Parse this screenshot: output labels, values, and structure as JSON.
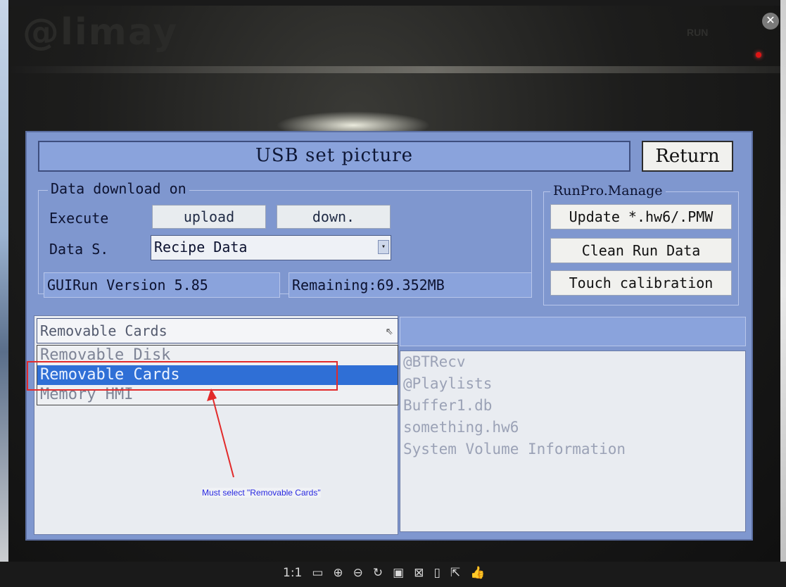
{
  "photo": {
    "brand": "@limay",
    "run_label": "RUN"
  },
  "hmi": {
    "title": "USB set picture",
    "return_label": "Return",
    "data_download": {
      "group_label": "Data download on",
      "execute_label": "Execute",
      "upload_label": "upload",
      "down_label": "down.",
      "data_source_label": "Data S.",
      "data_source_value": "Recipe Data",
      "version": "GUIRun Version 5.85",
      "remaining": "Remaining:69.352MB"
    },
    "runpro": {
      "group_label": "RunPro.Manage",
      "update_label": "Update *.hw6/.PMW",
      "clean_label": "Clean Run Data",
      "touch_label": "Touch calibration"
    },
    "storage_select": {
      "selected": "Removable Cards",
      "options": [
        "Removable Disk",
        "Removable Cards",
        "Memory HMI"
      ]
    },
    "files": [
      "@BTRecv",
      "@Playlists",
      "Buffer1.db",
      "something.hw6",
      "System Volume Information"
    ]
  },
  "annotation": {
    "text": "Must select \"Removable Cards\""
  },
  "toolbar": {
    "zoom_label": "1:1",
    "icons": [
      "fit-screen-icon",
      "zoom-in-icon",
      "zoom-out-icon",
      "rotate-icon",
      "save-icon",
      "bookmark-icon",
      "phone-icon",
      "share-icon",
      "thumbs-up-icon"
    ]
  },
  "colors": {
    "hmi_background": "#7f97cf",
    "selection": "#2f6fd6",
    "annotation_box": "#e22a2a",
    "annotation_text": "#2828e0"
  }
}
